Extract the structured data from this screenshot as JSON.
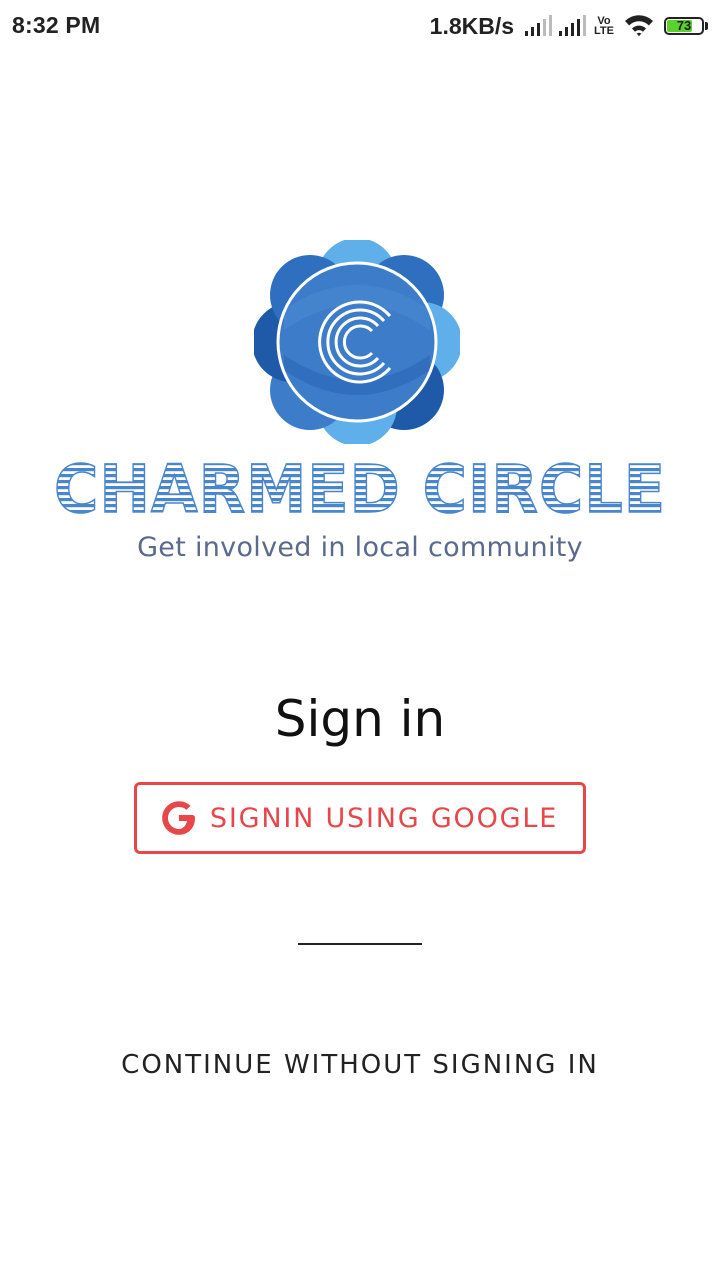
{
  "status_bar": {
    "time": "8:32 PM",
    "net_speed": "1.8KB/s",
    "volte_top": "Vo",
    "volte_bottom": "LTE",
    "battery_level": "73"
  },
  "logo": {
    "wordmark": "CHARMED CIRCLE",
    "emblem_letter": "C",
    "tagline": "Get involved in local community"
  },
  "sign_in": {
    "title": "Sign in",
    "google_button_label": "SIGNIN USING GOOGLE",
    "continue_label": "CONTINUE WITHOUT SIGNING IN"
  },
  "colors": {
    "accent_red": "#e8474a",
    "logo_blue": "#3d7cc9",
    "logo_light_blue": "#5fb0ea",
    "logo_dark_blue": "#1f5aa8"
  },
  "icons": [
    "signal-icon",
    "signal-icon",
    "volte-icon",
    "wifi-icon",
    "battery-icon",
    "google-icon"
  ]
}
